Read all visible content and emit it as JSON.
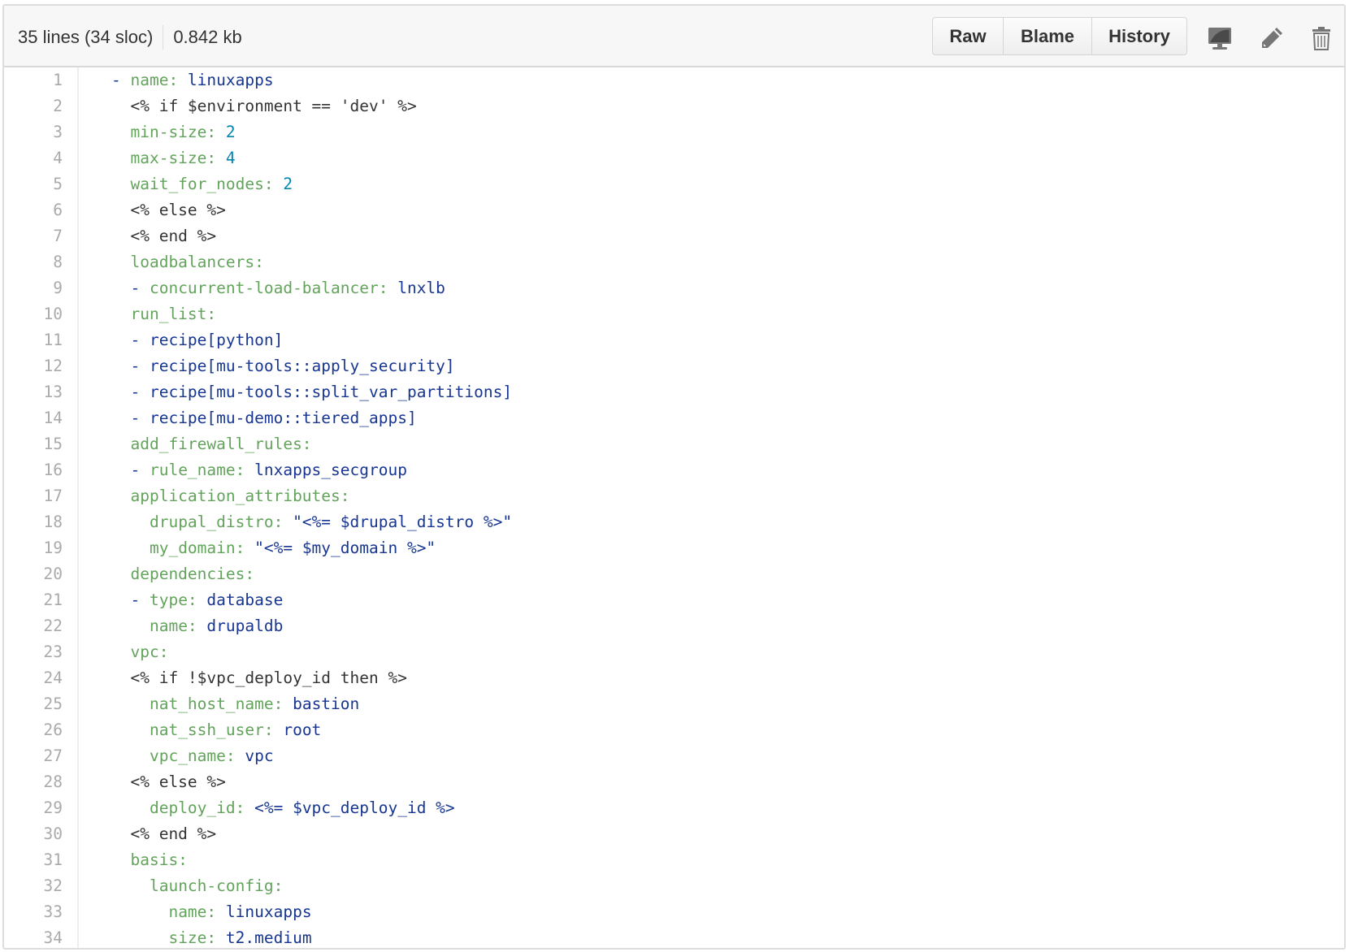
{
  "header": {
    "lines_info": "35 lines (34 sloc)",
    "size": "0.842 kb",
    "buttons": {
      "raw": "Raw",
      "blame": "Blame",
      "history": "History"
    },
    "icons": [
      "desktop-icon",
      "pencil-icon",
      "trash-icon"
    ]
  },
  "colors": {
    "key": "#63a35c",
    "string_value": "#183691",
    "number_value": "#0086b3",
    "plain": "#333333",
    "line_number": "#aaaaaa"
  },
  "lines": [
    {
      "n": "1",
      "indent": "",
      "dash": "- ",
      "key": "name:",
      "val": " linuxapps",
      "vtype": "v",
      "plain": ""
    },
    {
      "n": "2",
      "indent": "  ",
      "dash": "",
      "key": "",
      "val": "",
      "vtype": "v",
      "plain": "<% if $environment == 'dev' %>"
    },
    {
      "n": "3",
      "indent": "  ",
      "dash": "",
      "key": "min-size:",
      "val": " 2",
      "vtype": "n",
      "plain": ""
    },
    {
      "n": "4",
      "indent": "  ",
      "dash": "",
      "key": "max-size:",
      "val": " 4",
      "vtype": "n",
      "plain": ""
    },
    {
      "n": "5",
      "indent": "  ",
      "dash": "",
      "key": "wait_for_nodes:",
      "val": " 2",
      "vtype": "n",
      "plain": ""
    },
    {
      "n": "6",
      "indent": "  ",
      "dash": "",
      "key": "",
      "val": "",
      "vtype": "v",
      "plain": "<% else %>"
    },
    {
      "n": "7",
      "indent": "  ",
      "dash": "",
      "key": "",
      "val": "",
      "vtype": "v",
      "plain": "<% end %>"
    },
    {
      "n": "8",
      "indent": "  ",
      "dash": "",
      "key": "loadbalancers:",
      "val": "",
      "vtype": "v",
      "plain": ""
    },
    {
      "n": "9",
      "indent": "  ",
      "dash": "- ",
      "key": "concurrent-load-balancer:",
      "val": " lnxlb",
      "vtype": "v",
      "plain": ""
    },
    {
      "n": "10",
      "indent": "  ",
      "dash": "",
      "key": "run_list:",
      "val": "",
      "vtype": "v",
      "plain": ""
    },
    {
      "n": "11",
      "indent": "  ",
      "dash": "- ",
      "key": "",
      "val": "recipe[python]",
      "vtype": "v",
      "plain": ""
    },
    {
      "n": "12",
      "indent": "  ",
      "dash": "- ",
      "key": "",
      "val": "recipe[mu-tools::apply_security]",
      "vtype": "v",
      "plain": ""
    },
    {
      "n": "13",
      "indent": "  ",
      "dash": "- ",
      "key": "",
      "val": "recipe[mu-tools::split_var_partitions]",
      "vtype": "v",
      "plain": ""
    },
    {
      "n": "14",
      "indent": "  ",
      "dash": "- ",
      "key": "",
      "val": "recipe[mu-demo::tiered_apps]",
      "vtype": "v",
      "plain": ""
    },
    {
      "n": "15",
      "indent": "  ",
      "dash": "",
      "key": "add_firewall_rules:",
      "val": "",
      "vtype": "v",
      "plain": ""
    },
    {
      "n": "16",
      "indent": "  ",
      "dash": "- ",
      "key": "rule_name:",
      "val": " lnxapps_secgroup",
      "vtype": "v",
      "plain": ""
    },
    {
      "n": "17",
      "indent": "  ",
      "dash": "",
      "key": "application_attributes:",
      "val": "",
      "vtype": "v",
      "plain": ""
    },
    {
      "n": "18",
      "indent": "    ",
      "dash": "",
      "key": "drupal_distro:",
      "val": " \"<%= $drupal_distro %>\"",
      "vtype": "v",
      "plain": ""
    },
    {
      "n": "19",
      "indent": "    ",
      "dash": "",
      "key": "my_domain:",
      "val": " \"<%= $my_domain %>\"",
      "vtype": "v",
      "plain": ""
    },
    {
      "n": "20",
      "indent": "  ",
      "dash": "",
      "key": "dependencies:",
      "val": "",
      "vtype": "v",
      "plain": ""
    },
    {
      "n": "21",
      "indent": "  ",
      "dash": "- ",
      "key": "type:",
      "val": " database",
      "vtype": "v",
      "plain": ""
    },
    {
      "n": "22",
      "indent": "    ",
      "dash": "",
      "key": "name:",
      "val": " drupaldb",
      "vtype": "v",
      "plain": ""
    },
    {
      "n": "23",
      "indent": "  ",
      "dash": "",
      "key": "vpc:",
      "val": "",
      "vtype": "v",
      "plain": ""
    },
    {
      "n": "24",
      "indent": "  ",
      "dash": "",
      "key": "",
      "val": "",
      "vtype": "v",
      "plain": "<% if !$vpc_deploy_id then %>"
    },
    {
      "n": "25",
      "indent": "    ",
      "dash": "",
      "key": "nat_host_name:",
      "val": " bastion",
      "vtype": "v",
      "plain": ""
    },
    {
      "n": "26",
      "indent": "    ",
      "dash": "",
      "key": "nat_ssh_user:",
      "val": " root",
      "vtype": "v",
      "plain": ""
    },
    {
      "n": "27",
      "indent": "    ",
      "dash": "",
      "key": "vpc_name:",
      "val": " vpc",
      "vtype": "v",
      "plain": ""
    },
    {
      "n": "28",
      "indent": "  ",
      "dash": "",
      "key": "",
      "val": "",
      "vtype": "v",
      "plain": "<% else %>"
    },
    {
      "n": "29",
      "indent": "    ",
      "dash": "",
      "key": "deploy_id:",
      "val": " <%= $vpc_deploy_id %>",
      "vtype": "v",
      "plain": ""
    },
    {
      "n": "30",
      "indent": "  ",
      "dash": "",
      "key": "",
      "val": "",
      "vtype": "v",
      "plain": "<% end %>"
    },
    {
      "n": "31",
      "indent": "  ",
      "dash": "",
      "key": "basis:",
      "val": "",
      "vtype": "v",
      "plain": ""
    },
    {
      "n": "32",
      "indent": "    ",
      "dash": "",
      "key": "launch-config:",
      "val": "",
      "vtype": "v",
      "plain": ""
    },
    {
      "n": "33",
      "indent": "      ",
      "dash": "",
      "key": "name:",
      "val": " linuxapps",
      "vtype": "v",
      "plain": ""
    },
    {
      "n": "34",
      "indent": "      ",
      "dash": "",
      "key": "size:",
      "val": " t2.medium",
      "vtype": "v",
      "plain": ""
    }
  ]
}
